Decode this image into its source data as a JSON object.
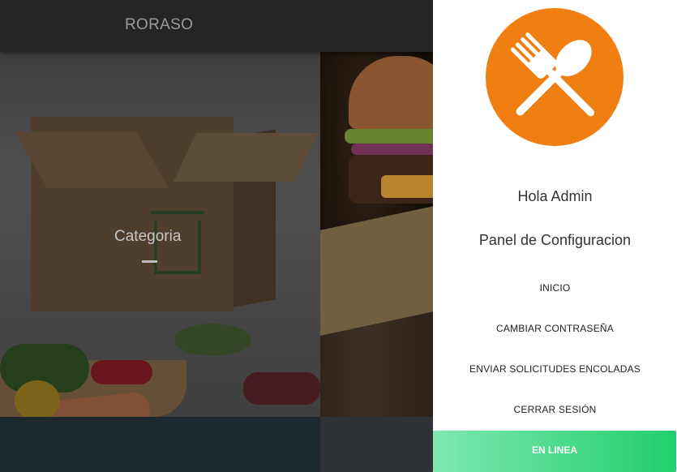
{
  "app": {
    "title": "RORASO"
  },
  "tiles": [
    {
      "label": "Categoria"
    }
  ],
  "drawer": {
    "logo_icon": "fork-spoon-crossed-icon",
    "greeting": "Hola Admin",
    "panel_title": "Panel de Configuracion",
    "menu": [
      {
        "label": "INICIO"
      },
      {
        "label": "CAMBIAR CONTRASEÑA"
      },
      {
        "label": "ENVIAR SOLICITUDES ENCOLADAS"
      },
      {
        "label": "CERRAR SESIÓN"
      }
    ],
    "status": "EN LINEA"
  },
  "colors": {
    "accent_orange": "#f07e10",
    "status_green": "#22cf6d",
    "topbar": "#2c2c2c"
  }
}
